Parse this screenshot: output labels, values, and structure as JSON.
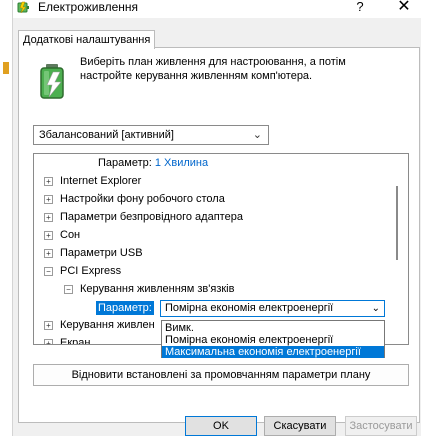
{
  "window": {
    "title": "Електроживлення",
    "help": "?",
    "close": "✕"
  },
  "tab": {
    "label": "Додаткові налаштування"
  },
  "intro": "Виберіть план живлення для настроювання, а потім настройте керування живленням комп'ютера.",
  "plan": {
    "value": "Збалансований [активний]"
  },
  "tree": {
    "param_label": "Параметр:",
    "param_value": "1 Хвилина",
    "items": [
      "Internet Explorer",
      "Настройки фону робочого стола",
      "Параметри безпровідного адаптера",
      "Сон",
      "Параметри USB",
      "PCI Express",
      "Керування живленням зв'язків",
      "Параметр:",
      "Керування живлен",
      "Екран"
    ],
    "selected_value": "Помірна економія електроенергії"
  },
  "dropdown": {
    "options": [
      "Вимк.",
      "Помірна економія електроенергії",
      "Максимальна економія електроенергії"
    ],
    "highlighted": "Максимальна економія електроенергії"
  },
  "restore_button": "Відновити встановлені за промовчанням параметри плану",
  "buttons": {
    "ok": "OK",
    "cancel": "Скасувати",
    "apply": "Застосувати"
  },
  "colors": {
    "accent": "#0078d7",
    "link": "#0066cc"
  },
  "icons": [
    "battery-power-icon",
    "close-icon",
    "help-icon",
    "chevron-down-icon",
    "expand-icon",
    "collapse-icon"
  ]
}
